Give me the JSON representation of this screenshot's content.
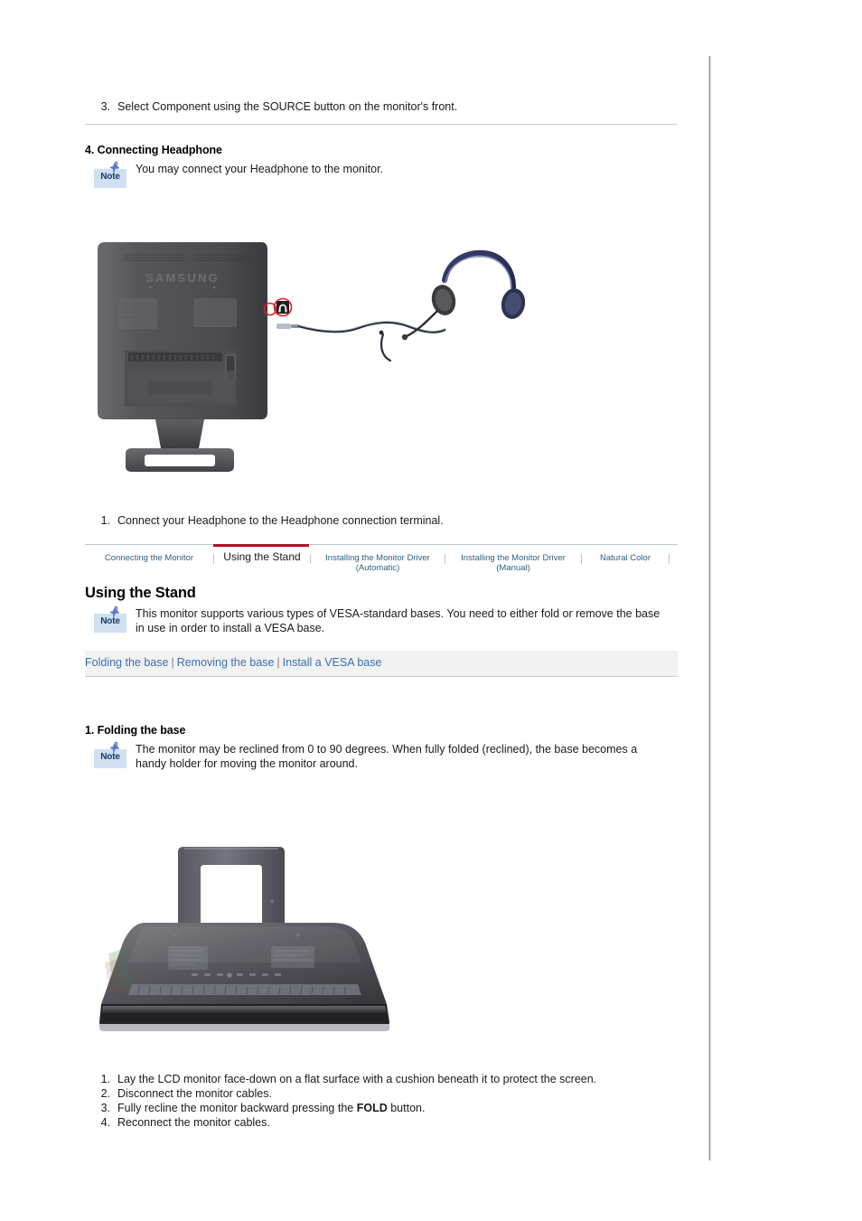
{
  "document": {
    "title": "Using the Stand",
    "note_label": "Note"
  },
  "top_section": {
    "step": {
      "num": "3.",
      "text": "Select Component using the SOURCE button on the monitor's front."
    }
  },
  "headphone_section": {
    "heading": "4. Connecting Headphone",
    "note": "You may connect your Headphone to the monitor.",
    "figure_alt": "Rear view of Samsung LCD monitor with headphone jack circled in red and headphones connected",
    "brand_on_monitor": "SAMSUNG",
    "step": {
      "num": "1.",
      "text": "Connect your Headphone to the Headphone connection terminal."
    }
  },
  "tabs": {
    "active_index": 1,
    "items": [
      {
        "label": "Connecting the Monitor",
        "active": false
      },
      {
        "label": "Using the Stand",
        "active": true
      },
      {
        "label": "Installing the Monitor Driver\n(Automatic)",
        "active": false
      },
      {
        "label": "Installing the Monitor Driver\n(Manual)",
        "active": false
      },
      {
        "label": "Natural Color",
        "active": false
      }
    ],
    "active_color": "#b11226",
    "link_color": "#2e5f86"
  },
  "stand_section": {
    "heading": "Using the Stand",
    "note": "This monitor supports various types of VESA-standard bases. You need to either fold or remove the base in use in order to install a VESA base.",
    "links": [
      "Folding the base",
      "Removing the base",
      "Install a VESA base"
    ],
    "link_separator": "|",
    "link_color": "#3b6fb5",
    "linkbar_bg": "#f2f2f2"
  },
  "folding_section": {
    "heading": "1. Folding the base",
    "note": "The monitor may be reclined from 0 to 90 degrees. When fully folded (reclined), the base becomes a handy holder for moving the monitor around.",
    "figure_alt": "Folded LCD monitor lying face-down with stand forming a carrying handle",
    "steps": [
      {
        "num": "1.",
        "pre": "Lay the LCD monitor face-down on a flat surface with a cushion beneath it to protect the screen.",
        "bold": "",
        "post": ""
      },
      {
        "num": "2.",
        "pre": "Disconnect the monitor cables.",
        "bold": "",
        "post": ""
      },
      {
        "num": "3.",
        "pre": "Fully recline the monitor backward pressing the ",
        "bold": "FOLD",
        "post": " button."
      },
      {
        "num": "4.",
        "pre": "Reconnect the monitor cables.",
        "bold": "",
        "post": ""
      }
    ]
  }
}
